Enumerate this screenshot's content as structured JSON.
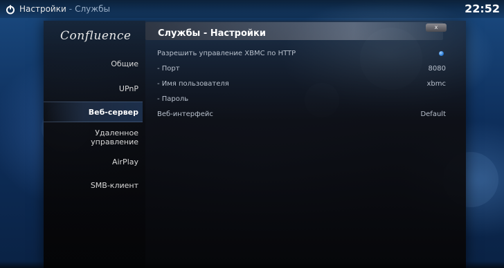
{
  "topbar": {
    "icon": "power-icon",
    "breadcrumb_root": "Настройки",
    "separator": "-",
    "breadcrumb_current": "Службы",
    "clock": "22:52"
  },
  "sidebar": {
    "logo": "Confluence",
    "items": [
      {
        "label": "Общие",
        "active": false
      },
      {
        "label": "UPnP",
        "active": false
      },
      {
        "label": "Веб-сервер",
        "active": true
      },
      {
        "label": "Удаленное управление",
        "active": false
      },
      {
        "label": "AirPlay",
        "active": false
      },
      {
        "label": "SMB-клиент",
        "active": false
      }
    ]
  },
  "dialog": {
    "title": "Службы - Настройки",
    "close_label": "x"
  },
  "settings": [
    {
      "label": "Разрешить управление XBMC по HTTP",
      "value": "",
      "control": "radio-on"
    },
    {
      "label": "- Порт",
      "value": "8080"
    },
    {
      "label": "- Имя пользователя",
      "value": "xbmc"
    },
    {
      "label": "- Пароль",
      "value": ""
    },
    {
      "label": "Веб-интерфейс",
      "value": "Default"
    }
  ],
  "colors": {
    "accent": "#2e7fd8",
    "background": "#0e2f5c"
  }
}
